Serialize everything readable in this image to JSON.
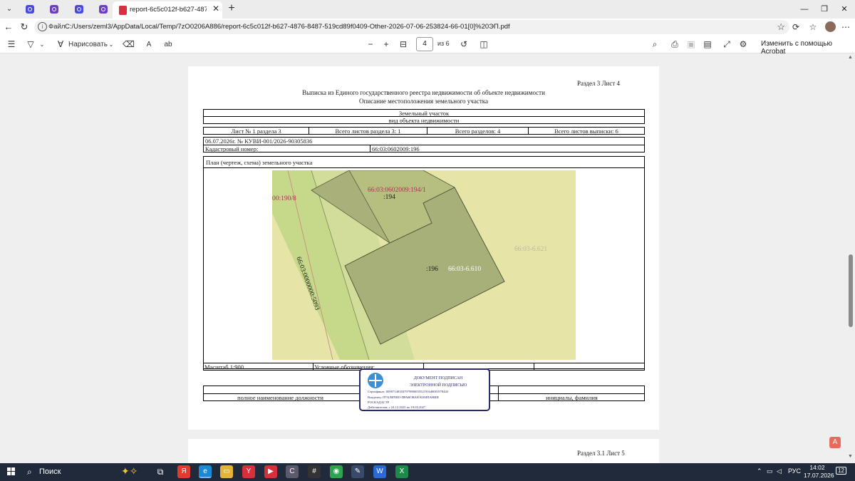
{
  "browser": {
    "active_tab_title": "report-6c5c012f-b627-4876-8487",
    "close_tab": "✕",
    "new_tab": "+",
    "address_scheme": "Файл",
    "address_path": "C:/Users/zeml3/AppData/Local/Temp/7zO0206A886/report-6c5c012f-b627-4876-8487-519cd89f0409-Other-2026-07-06-253824-66-01[0]%20ЭП.pdf"
  },
  "pdf_toolbar": {
    "draw_label": "Нарисовать",
    "page_current": "4",
    "page_total": "из 6",
    "edit_acrobat": "Изменить с помощью Acrobat"
  },
  "document": {
    "section_sheet": "Раздел 3   Лист 4",
    "title_line1": "Выписка из Единого государственного реестра недвижимости об объекте недвижимости",
    "title_line2": "Описание местоположения земельного участка",
    "object_type": "Земельный участок",
    "object_type_caption": "вид объекта недвижимости",
    "sheet_of_section": "Лист № 1 раздела 3",
    "total_sheets_section": "Всего листов раздела 3: 1",
    "total_sections": "Всего разделов: 4",
    "total_sheets_extract": "Всего листов выписки: 6",
    "date_number": "06.07.2026г. № КУВИ-001/2026-90305836",
    "cadastral_label": "Кадастровый номер:",
    "cadastral_value": "66:03:0602009:196",
    "plan_label": "План (чертеж, схема) земельного участка",
    "scale": "Масштаб 1:900",
    "legend": "Условные обозначения:",
    "position_caption": "полное наименование должности",
    "name_caption": "инициалы, фамилия",
    "next_section_sheet": "Раздел 3.1  Лист 5"
  },
  "map_labels": {
    "parcel_194_1": "66:03:0602009:194/1",
    "parcel_194": ":194",
    "parcel_190_8": "00:190/8",
    "road": "66:03:0000000:5093",
    "parcel_196": ":196",
    "zone_610": "66:03-6.610",
    "zone_621": "66:03-6.621"
  },
  "signature_stamp": {
    "line1": "ДОКУМЕНТ ПОДПИСАН",
    "line2": "ЭЛЕКТРОННОЙ ПОДПИСЬЮ",
    "certificate": "Сертификат: 00997148184797998005552191648001978443",
    "owner": "Владелец: ПУБЛИЧНО-ПРАВОВАЯ КОМПАНИЯ",
    "owner2": "РОСКАДАСТР",
    "validity": "Действителен: с 24.12.2025 по 19.03.2027"
  },
  "taskbar": {
    "search_label": "Поиск",
    "lang": "РУС",
    "time": "14:02",
    "date": "17.07.2026",
    "notifications": "12"
  },
  "colors": {
    "map_background": "#e6e4a6",
    "road_strip": "#c6d98a",
    "parcel_fill": "#a9b07a",
    "parcel_label": "#b03050"
  }
}
